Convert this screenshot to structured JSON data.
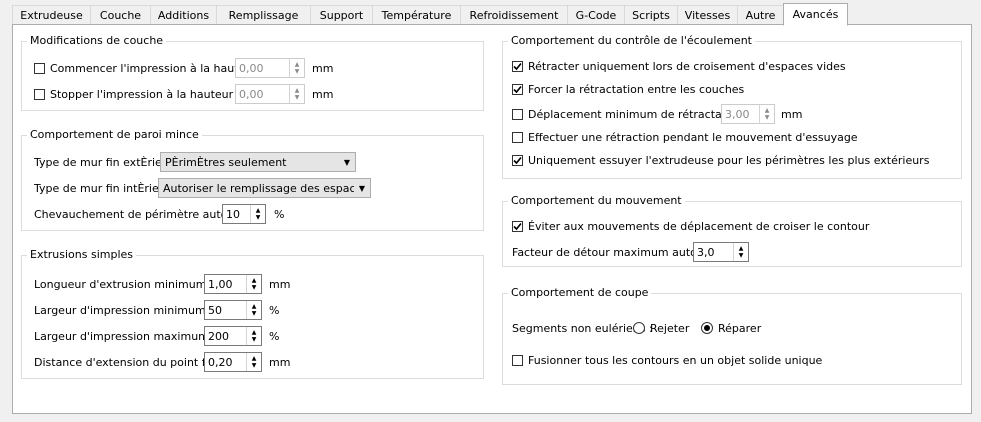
{
  "tabs": [
    "Extrudeuse",
    "Couche",
    "Additions",
    "Remplissage",
    "Support",
    "Température",
    "Refroidissement",
    "G-Code",
    "Scripts",
    "Vitesses",
    "Autre",
    "Avancés"
  ],
  "active_tab": "Avancés",
  "layer_changes": {
    "title": "Modifications de couche",
    "start": {
      "label": "Commencer l'impression à la hauteur",
      "value": "0,00",
      "unit": "mm",
      "checked": false
    },
    "stop": {
      "label": "Stopper  l'impression à la hauteur",
      "value": "0,00",
      "unit": "mm",
      "checked": false
    }
  },
  "thin_wall": {
    "title": "Comportement de paroi mince",
    "outer_label": "Type de mur fin extÈrieur",
    "outer_value": "PÈrimÈtres seulement",
    "inner_label": "Type de mur fin intÈrieur",
    "inner_value": "Autoriser le remplissage des espaces",
    "overlap_label": "Chevauchement de périmètre autorisé",
    "overlap_value": "10",
    "overlap_unit": "%"
  },
  "simple_extrusions": {
    "title": "Extrusions simples",
    "rows": [
      {
        "label": "Longueur d'extrusion minimum",
        "value": "1,00",
        "unit": "mm"
      },
      {
        "label": "Largeur d'impression minimum",
        "value": "50",
        "unit": "%"
      },
      {
        "label": "Largeur d'impression maximum",
        "value": "200",
        "unit": "%"
      },
      {
        "label": "Distance d'extension du point final",
        "value": "0,20",
        "unit": "mm"
      }
    ]
  },
  "flow_control": {
    "title": "Comportement du contrôle de l'écoulement",
    "items": [
      {
        "label": "Rétracter uniquement lors de croisement d'espaces vides",
        "checked": true
      },
      {
        "label": "Forcer la rétractation entre les couches",
        "checked": true
      },
      {
        "label": "Déplacement minimum de rétractation",
        "checked": false
      },
      {
        "label": "Effectuer une rétraction pendant le mouvement d'essuyage",
        "checked": false
      },
      {
        "label": "Uniquement essuyer l'extrudeuse pour les périmètres les plus extérieurs",
        "checked": true
      }
    ],
    "min_travel_value": "3,00",
    "min_travel_unit": "mm"
  },
  "movement": {
    "title": "Comportement du mouvement",
    "avoid_label": "Éviter aux mouvements de déplacement de croiser le contour",
    "avoid_checked": true,
    "detour_label": "Facteur de détour maximum autorisé",
    "detour_value": "3,0"
  },
  "cutting": {
    "title": "Comportement de coupe",
    "non_eulerian_label": "Segments non eulériens :",
    "reject_label": "Rejeter",
    "repair_label": "Réparer",
    "selected": "Réparer",
    "merge_label": "Fusionner tous les contours en un objet solide unique",
    "merge_checked": false
  }
}
